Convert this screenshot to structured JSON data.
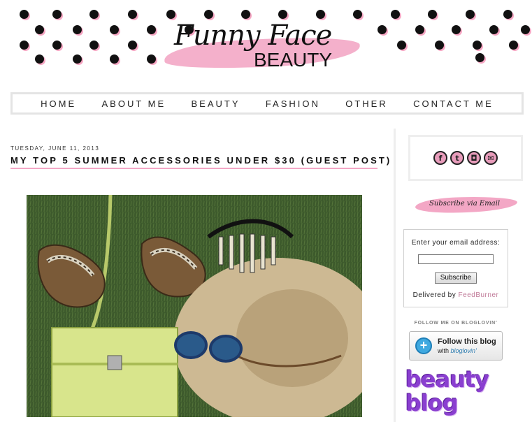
{
  "header": {
    "logo_title": "Funny Face",
    "logo_subtitle": "BEAUTY"
  },
  "nav": {
    "items": [
      "HOME",
      "ABOUT ME",
      "BEAUTY",
      "FASHION",
      "OTHER",
      "CONTACT ME"
    ]
  },
  "post": {
    "date": "TUESDAY, JUNE 11, 2013",
    "title": "MY TOP 5 SUMMER ACCESSORIES UNDER $30 (GUEST POST)"
  },
  "sidebar": {
    "social_icons": [
      "facebook-icon",
      "twitter-icon",
      "instagram-icon",
      "email-icon"
    ],
    "subscribe_banner": "Subscribe via Email",
    "feedburner": {
      "label": "Enter your email address:",
      "input_value": "",
      "button": "Subscribe",
      "delivered_prefix": "Delivered by",
      "delivered_link": "FeedBurner"
    },
    "bloglovin": {
      "heading": "FOLLOW ME ON BLOGLOVIN'",
      "line1": "Follow this blog",
      "line2_prefix": "with",
      "line2_brand": "bloglovin'"
    },
    "beauty_blog": {
      "line1": "beauty",
      "line2": "blog"
    }
  },
  "colors": {
    "accent_pink": "#f3a7c5",
    "dot_black": "#111111",
    "link_pink": "#c07a98",
    "bloglovin_blue": "#3fa9e0",
    "beauty_purple": "#8a3fd0"
  }
}
